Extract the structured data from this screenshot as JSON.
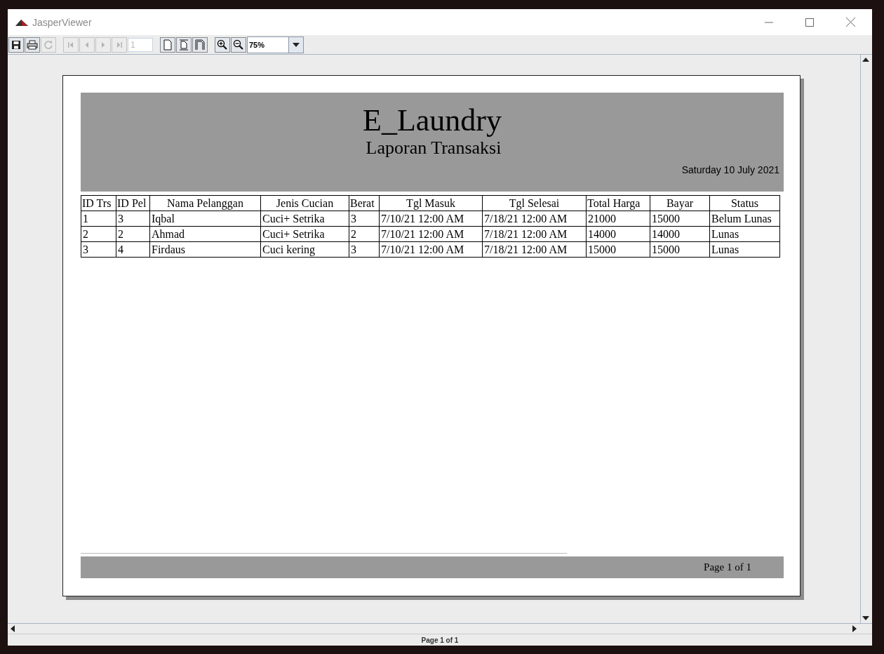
{
  "window": {
    "title": "JasperViewer"
  },
  "toolbar": {
    "file_buttons": [
      {
        "kind": "save",
        "disabled": false
      },
      {
        "kind": "print",
        "disabled": false
      },
      {
        "kind": "reload",
        "disabled": true
      }
    ],
    "nav_buttons": [
      {
        "kind": "first",
        "disabled": true
      },
      {
        "kind": "previous",
        "disabled": true
      },
      {
        "kind": "next",
        "disabled": true
      },
      {
        "kind": "last",
        "disabled": true
      }
    ],
    "page_field": {
      "value": "1",
      "disabled": true
    },
    "view_buttons": [
      {
        "kind": "actual-size"
      },
      {
        "kind": "fit-page"
      },
      {
        "kind": "fit-width"
      }
    ],
    "zoom_buttons": [
      {
        "kind": "zoom-in"
      },
      {
        "kind": "zoom-out"
      }
    ],
    "zoom_field": {
      "value": "75%"
    }
  },
  "report": {
    "title": "E_Laundry",
    "subtitle": "Laporan Transaksi",
    "date": "Saturday 10 July 2021",
    "columns": [
      "ID Trs",
      "ID Pel",
      "Nama Pelanggan",
      "Jenis Cucian",
      "Berat",
      "Tgl Masuk",
      "Tgl Selesai",
      "Total Harga",
      "Bayar",
      "Status"
    ],
    "rows": [
      [
        "1",
        "3",
        "Iqbal",
        "Cuci+ Setrika",
        "3",
        "7/10/21 12:00 AM",
        "7/18/21 12:00 AM",
        "21000",
        "15000",
        "Belum Lunas"
      ],
      [
        "2",
        "2",
        "Ahmad",
        "Cuci+ Setrika",
        "2",
        "7/10/21 12:00 AM",
        "7/18/21 12:00 AM",
        "14000",
        "14000",
        "Lunas"
      ],
      [
        "3",
        "4",
        "Firdaus",
        "Cuci kering",
        "3",
        "7/10/21 12:00 AM",
        "7/18/21 12:00 AM",
        "15000",
        "15000",
        "Lunas"
      ]
    ],
    "footer": "Page 1 of 1"
  },
  "status_bar": {
    "text": "Page 1 of 1"
  }
}
